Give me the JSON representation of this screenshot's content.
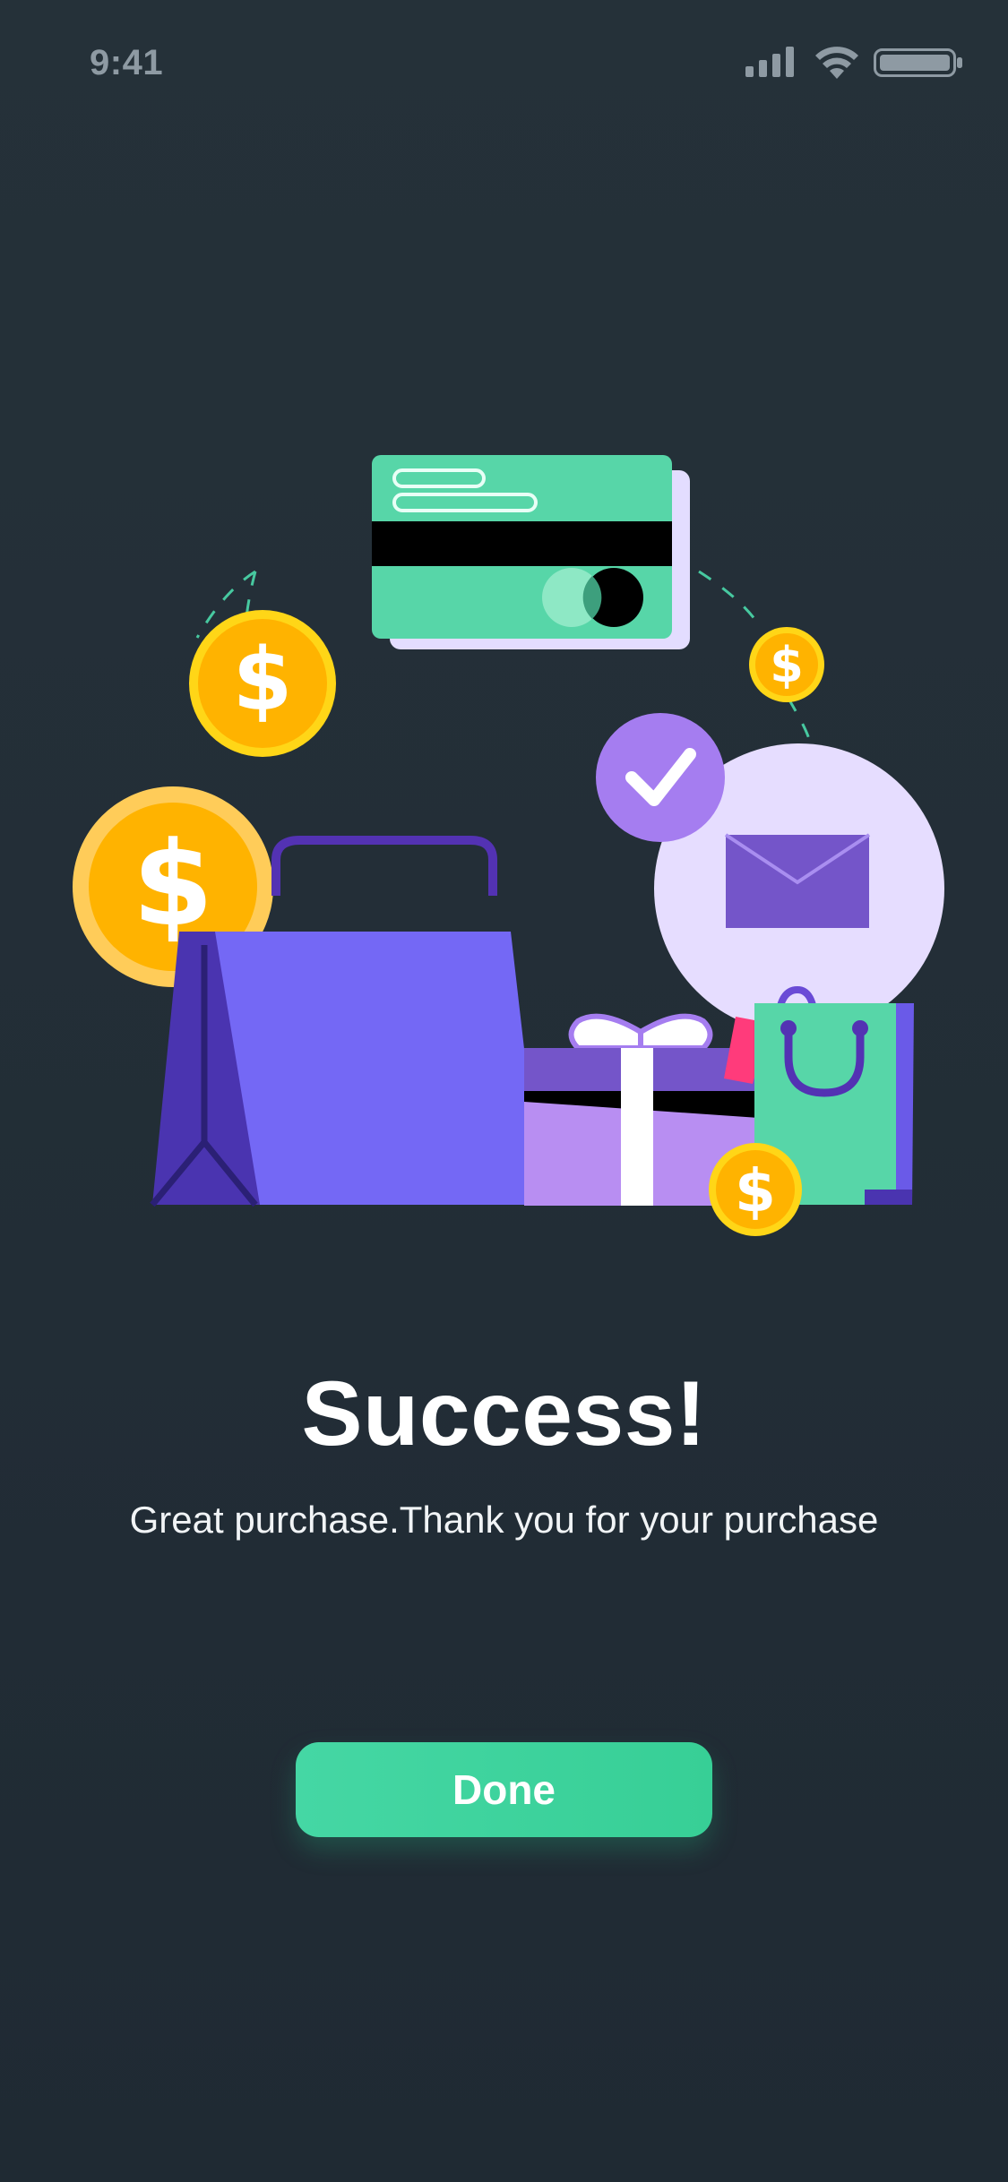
{
  "status_bar": {
    "time": "9:41",
    "icons": [
      "signal-icon",
      "wifi-icon",
      "battery-icon"
    ]
  },
  "illustration": {
    "icons": [
      "credit-card-icon",
      "dollar-coin-icon",
      "checkmark-icon",
      "envelope-icon",
      "shopping-bag-icon",
      "gift-box-icon"
    ],
    "coin_symbol": "$"
  },
  "main": {
    "title": "Success!",
    "subtitle": "Great purchase.Thank you for your purchase",
    "done_label": "Done"
  },
  "colors": {
    "background": "#24313a",
    "accent": "#3dd39c",
    "coin": "#ffb300",
    "bag_purple": "#7468f5",
    "card_green": "#57d6a8"
  }
}
